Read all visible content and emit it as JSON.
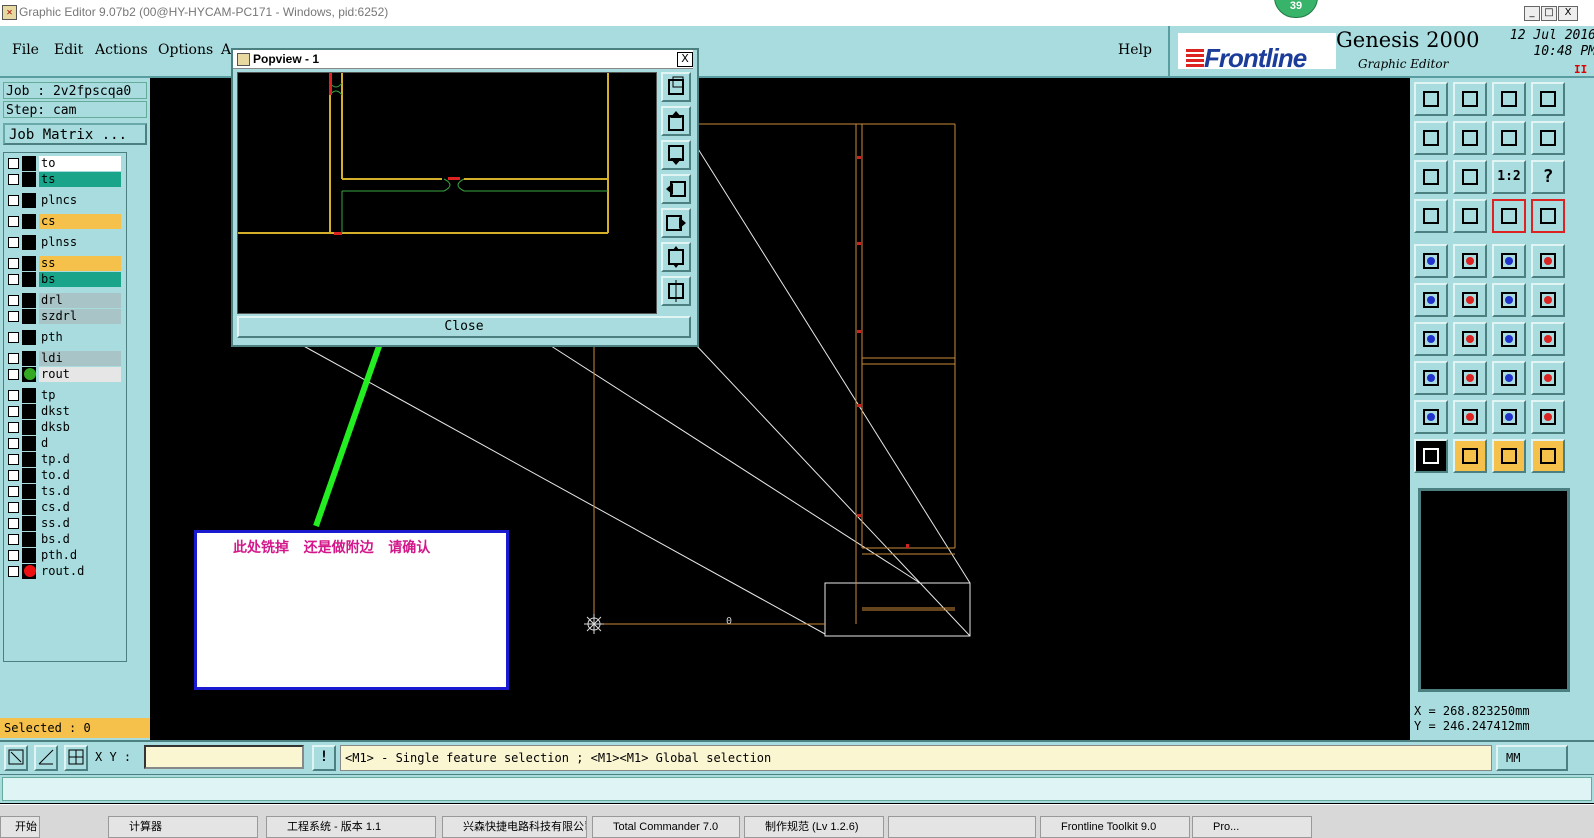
{
  "window": {
    "title": "Graphic Editor 9.07b2 (00@HY-HYCAM-PC171 - Windows, pid:6252)",
    "badge": "39",
    "minimize": "_",
    "maximize": "□",
    "close": "X"
  },
  "menu": {
    "items": [
      "File",
      "Edit",
      "Actions",
      "Options",
      "A"
    ],
    "help": "Help"
  },
  "brand": {
    "logo_text": "Frontline",
    "product": "Genesis 2000",
    "subtitle": "Graphic Editor",
    "date": "12 Jul 2016",
    "time": "10:48 PM",
    "indicator": "II"
  },
  "job": {
    "job_label": "Job : 2v2fpscqa0",
    "step_label": "Step: cam",
    "matrix_button": "Job Matrix ..."
  },
  "layers": [
    {
      "name": "to",
      "color": "#ffffff",
      "marker": "",
      "top": 0
    },
    {
      "name": "ts",
      "color": "#1aa58a",
      "marker": ""
    },
    {
      "name": "plncs",
      "color": "#a8dcde",
      "marker": ""
    },
    {
      "name": "cs",
      "color": "#f5c14a",
      "marker": ""
    },
    {
      "name": "plnss",
      "color": "#a8dcde",
      "marker": ""
    },
    {
      "name": "ss",
      "color": "#f5c14a",
      "marker": ""
    },
    {
      "name": "bs",
      "color": "#1aa58a",
      "marker": ""
    },
    {
      "name": "drl",
      "color": "#a9c4c6",
      "marker": ""
    },
    {
      "name": "szdrl",
      "color": "#a9c4c6",
      "marker": ""
    },
    {
      "name": "pth",
      "color": "#a8dcde",
      "marker": ""
    },
    {
      "name": "ldi",
      "color": "#a9c4c6",
      "marker": ""
    },
    {
      "name": "rout",
      "color": "#e6e6e6",
      "marker": "#33aa22"
    },
    {
      "name": "tp",
      "color": "#a8dcde",
      "marker": ""
    },
    {
      "name": "dkst",
      "color": "#a8dcde",
      "marker": ""
    },
    {
      "name": "dksb",
      "color": "#a8dcde",
      "marker": ""
    },
    {
      "name": "d",
      "color": "#a8dcde",
      "marker": ""
    },
    {
      "name": "tp.d",
      "color": "#a8dcde",
      "marker": ""
    },
    {
      "name": "to.d",
      "color": "#a8dcde",
      "marker": ""
    },
    {
      "name": "ts.d",
      "color": "#a8dcde",
      "marker": ""
    },
    {
      "name": "cs.d",
      "color": "#a8dcde",
      "marker": ""
    },
    {
      "name": "ss.d",
      "color": "#a8dcde",
      "marker": ""
    },
    {
      "name": "bs.d",
      "color": "#a8dcde",
      "marker": ""
    },
    {
      "name": "pth.d",
      "color": "#a8dcde",
      "marker": ""
    },
    {
      "name": "rout.d",
      "color": "#a8dcde",
      "marker": "#ee1111"
    }
  ],
  "selected": "Selected : 0",
  "popview": {
    "title": "Popview - 1",
    "close_x": "X",
    "close_button": "Close"
  },
  "note": {
    "text": "此处铣掉   还是做附边   请确认"
  },
  "toolbar": {
    "zoom_ratio_label": "1:2",
    "help_label": "?"
  },
  "coords": {
    "x": "X = 268.823250mm",
    "y": "Y = 246.247412mm"
  },
  "canvas": {
    "origin_label": "0"
  },
  "command": {
    "xy_label": "X Y :",
    "xy_value": "",
    "message": "<M1> - Single feature selection ; <M1><M1> Global selection",
    "units": "MM",
    "alert": "!"
  },
  "taskbar": {
    "start": "开始",
    "items": [
      "计算器",
      "工程系统 - 版本 1.1",
      "兴森快捷电路科技有限公司",
      "Total Commander 7.0",
      "制作规范 (Lv 1.2.6)",
      "",
      "Frontline Toolkit 9.0",
      "Pro..."
    ]
  },
  "colors": {
    "panel": "#a8dcde",
    "canvas": "#000000",
    "outline": "#c98a3a",
    "note_text": "#d2188a",
    "arrow": "#22ee22"
  }
}
